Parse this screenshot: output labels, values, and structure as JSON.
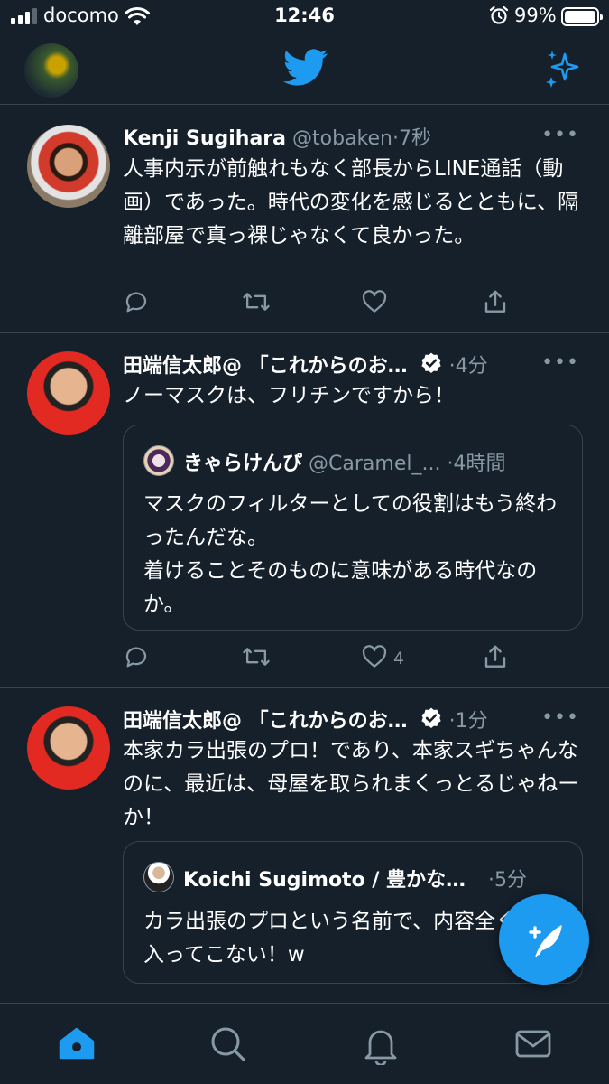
{
  "status_bar": {
    "carrier": "docomo",
    "time": "12:46",
    "battery": "99%"
  },
  "header": {
    "logo_icon": "twitter-bird-icon",
    "right_icon": "sparkle-icon"
  },
  "colors": {
    "background": "#15202b",
    "accent": "#1d9bf0",
    "muted": "#8899a6",
    "border": "#38444d"
  },
  "tweets": [
    {
      "name": "Kenji Sugihara",
      "handle": "@tobaken",
      "sep": "·",
      "time": "7秒",
      "more": "•••",
      "text": "人事内示が前触れもなく部長からLINE通話（動画）であった。時代の変化を感じるとともに、隔離部屋で真っ裸じゃなくて良かった。",
      "likes": ""
    },
    {
      "name": "田端信太郎@ 「これからのお…",
      "sep": "·",
      "time": "4分",
      "more": "•••",
      "text": "ノーマスクは、フリチンですから！",
      "quote": {
        "name": "きゃらけんぴ",
        "handle": "@Caramel_...",
        "sep": "·",
        "time": "4時間",
        "text": "マスクのフィルターとしての役割はもう終わったんだな。\n着けることそのものに意味がある時代なのか。"
      },
      "likes": "4"
    },
    {
      "name": "田端信太郎@ 「これからのお…",
      "sep": "·",
      "time": "1分",
      "more": "•••",
      "text": "本家カラ出張のプロ！であり、本家スギちゃんなのに、最近は、母屋を取られまくっとるじゃねーか！",
      "quote": {
        "name": "Koichi Sugimoto / 豊かな…",
        "sep": "·",
        "time": "5分",
        "text": "カラ出張のプロという名前で、内容全く頭に入ってこない！w"
      }
    }
  ],
  "nav": [
    "home-icon",
    "search-icon",
    "notifications-icon",
    "messages-icon"
  ]
}
